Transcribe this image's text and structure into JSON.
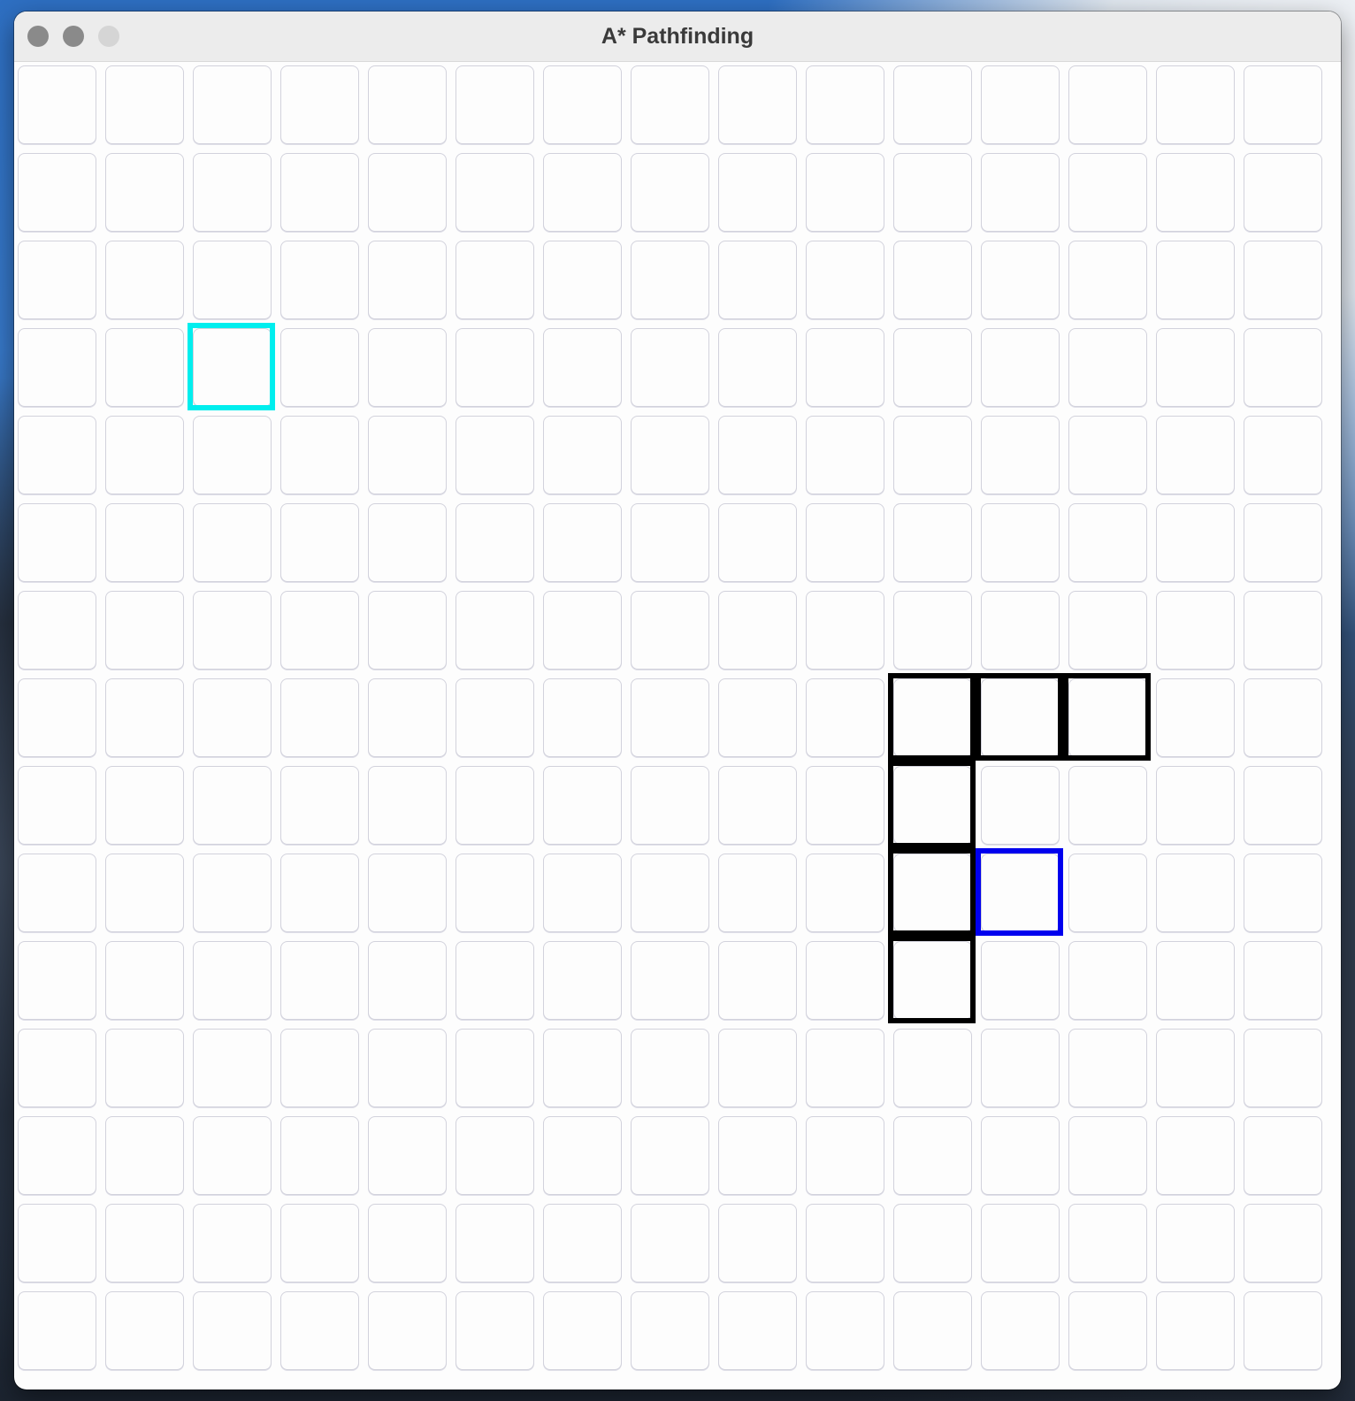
{
  "window": {
    "title": "A* Pathfinding"
  },
  "traffic_lights": [
    "close",
    "minimize",
    "zoom"
  ],
  "grid": {
    "rows": 15,
    "cols": 15,
    "start": {
      "row": 3,
      "col": 2
    },
    "goal": {
      "row": 9,
      "col": 11
    },
    "walls": [
      {
        "row": 7,
        "col": 10
      },
      {
        "row": 7,
        "col": 11
      },
      {
        "row": 7,
        "col": 12
      },
      {
        "row": 8,
        "col": 10
      },
      {
        "row": 9,
        "col": 10
      },
      {
        "row": 10,
        "col": 10
      }
    ]
  },
  "colors": {
    "start": "#00eeee",
    "goal": "#0000ee",
    "wall": "#000000"
  }
}
